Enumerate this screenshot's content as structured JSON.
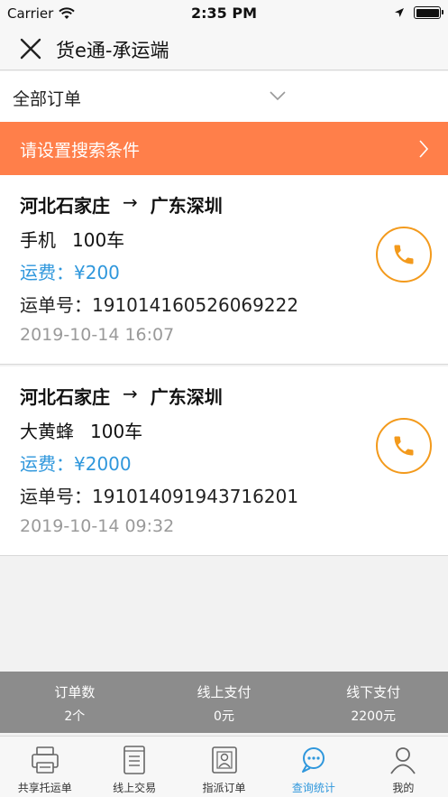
{
  "status_bar": {
    "carrier": "Carrier",
    "time": "2:35 PM"
  },
  "nav": {
    "title": "货e通-承运端",
    "close_icon": "close-icon"
  },
  "filter": {
    "label": "全部订单",
    "icon": "chevron-down-icon"
  },
  "search": {
    "label": "请设置搜索条件",
    "icon": "chevron-right-icon"
  },
  "colors": {
    "accent": "#ff7f4a",
    "fee_blue": "#2f97dc",
    "call_orange": "#f39a1c",
    "summary_bg": "#8c8c8c"
  },
  "orders": [
    {
      "from": "河北石家庄",
      "arrow": "→",
      "to": "广东深圳",
      "goods_name": "手机",
      "goods_qty": "100车",
      "fee": "运费：¥200",
      "waybill": "运单号：191014160526069222",
      "date": "2019-10-14 16:07"
    },
    {
      "from": "河北石家庄",
      "arrow": "→",
      "to": "广东深圳",
      "goods_name": "大黄蜂",
      "goods_qty": "100车",
      "fee": "运费：¥2000",
      "waybill": "运单号：191014091943716201",
      "date": "2019-10-14 09:32"
    }
  ],
  "summary": [
    {
      "label": "订单数",
      "value": "2个"
    },
    {
      "label": "线上支付",
      "value": "0元"
    },
    {
      "label": "线下支付",
      "value": "2200元"
    }
  ],
  "tabs": [
    {
      "label": "共享托运单",
      "icon": "printer-icon",
      "active": false
    },
    {
      "label": "线上交易",
      "icon": "document-list-icon",
      "active": false
    },
    {
      "label": "指派订单",
      "icon": "assign-user-icon",
      "active": false
    },
    {
      "label": "查询统计",
      "icon": "search-chat-icon",
      "active": true
    },
    {
      "label": "我的",
      "icon": "user-icon",
      "active": false
    }
  ]
}
